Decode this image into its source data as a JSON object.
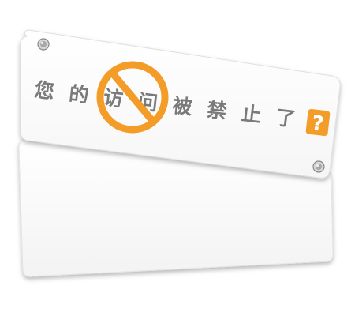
{
  "message": {
    "characters": [
      "您",
      "的",
      "访",
      "问",
      "被",
      "禁",
      "止",
      "了"
    ],
    "help_mark": "?"
  },
  "colors": {
    "text": "#7a7a7a",
    "accent": "#f39c28",
    "sign_face": "#ffffff",
    "sign_edge": "#d9d9d9",
    "shadow": "#9a9a9a"
  },
  "icons": {
    "prohibition": "prohibited-icon",
    "help": "question-icon",
    "screws": "screw-icon"
  }
}
